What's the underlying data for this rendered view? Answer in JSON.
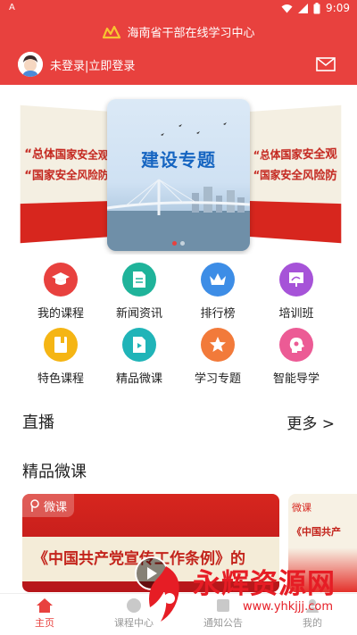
{
  "status_bar": {
    "left_indicator": "A",
    "time": "9:09"
  },
  "header": {
    "app_title": "海南省干部在线学习中心",
    "user_status": "未登录|立即登录"
  },
  "banner": {
    "center_title": "建设专题",
    "side_left_line1": "“总体国家安全观",
    "side_left_line2": "“国家安全风险防",
    "side_right_line1": "“总体国家安全观",
    "side_right_line2": "“国家安全风险防",
    "active_slide_index": 1,
    "slide_count": 2
  },
  "menu": [
    {
      "label": "我的课程",
      "icon": "graduation-cap-icon",
      "color": "#e8413e"
    },
    {
      "label": "新闻资讯",
      "icon": "document-icon",
      "color": "#1fb39a"
    },
    {
      "label": "排行榜",
      "icon": "crown-icon",
      "color": "#3d8de6"
    },
    {
      "label": "培训班",
      "icon": "easel-icon",
      "color": "#a653d8"
    },
    {
      "label": "特色课程",
      "icon": "book-icon",
      "color": "#f5b514"
    },
    {
      "label": "精品微课",
      "icon": "video-file-icon",
      "color": "#20b4b8"
    },
    {
      "label": "学习专题",
      "icon": "star-icon",
      "color": "#f27a3a"
    },
    {
      "label": "智能导学",
      "icon": "brain-icon",
      "color": "#ec5b95"
    }
  ],
  "sections": {
    "live_title": "直播",
    "live_more": "更多 >",
    "micro_title": "精品微课"
  },
  "cards": [
    {
      "badge": "微课",
      "title": "《中国共产党宣传工作条例》的"
    },
    {
      "badge": "微课",
      "title": "《中国共产"
    }
  ],
  "tabs": [
    {
      "label": "主页",
      "icon": "home-icon",
      "active": true
    },
    {
      "label": "课程中心",
      "icon": "course-icon",
      "active": false
    },
    {
      "label": "通知公告",
      "icon": "notice-icon",
      "active": false
    },
    {
      "label": "我的",
      "icon": "user-icon",
      "active": false
    }
  ],
  "watermark": {
    "text": "永辉资源网",
    "url": "www.yhkjjj.com"
  },
  "colors": {
    "primary": "#e8413e"
  }
}
